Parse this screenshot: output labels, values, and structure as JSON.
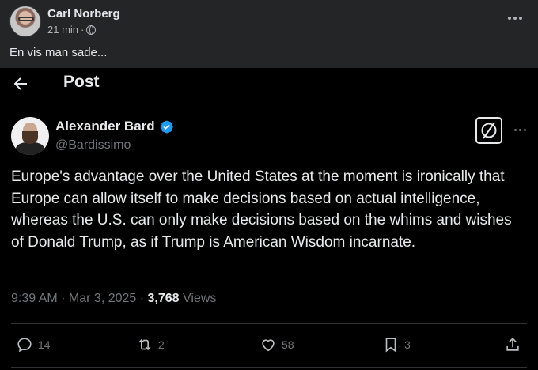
{
  "facebook_post": {
    "author_name": "Carl Norberg",
    "time": "21 min",
    "separator": "·",
    "caption": "En vis man sade..."
  },
  "x_post": {
    "header_title": "Post",
    "author": {
      "name": "Alexander Bard",
      "handle": "@Bardissimo",
      "verified_color": "#1d9bf0"
    },
    "text": "Europe's advantage over the United States at the moment is ironically that Europe can allow itself to make decisions based on actual intelligence, whereas the U.S. can only make decisions based on the whims and wishes of Donald Trump, as if Trump is American Wisdom incarnate.",
    "timestamp": "9:39 AM · Mar 3, 2025 · ",
    "views_count": "3,768",
    "views_label": " Views",
    "actions": {
      "replies": "14",
      "reposts": "2",
      "likes": "58",
      "bookmarks": "3"
    }
  },
  "icons": [
    "globe-icon",
    "more-options-icon",
    "back-arrow-icon",
    "verified-badge-icon",
    "grok-icon",
    "reply-icon",
    "repost-icon",
    "like-icon",
    "bookmark-icon",
    "share-icon"
  ]
}
